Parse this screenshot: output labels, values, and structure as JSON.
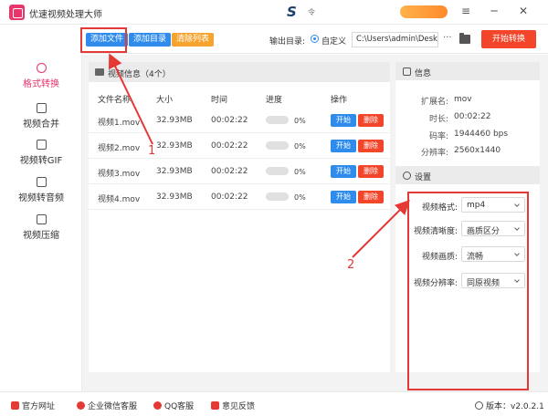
{
  "app": {
    "title": "优速视频处理大师",
    "brand_sub": "令"
  },
  "window_controls": [
    "≡",
    "─",
    "✕"
  ],
  "toolbar": {
    "add_file": "添加文件",
    "add_dir": "添加目录",
    "clear_list": "清除列表",
    "output_label": "输出目录:",
    "custom_label": "自定义",
    "path_value": "C:\\Users\\admin\\Deskto",
    "more": "···",
    "start_all": "开始转换"
  },
  "sidebar": {
    "items": [
      {
        "label": "格式转换",
        "icon": "format-convert-icon",
        "active": true
      },
      {
        "label": "视频合并",
        "icon": "video-merge-icon",
        "active": false
      },
      {
        "label": "视频转GIF",
        "icon": "gif-icon",
        "active": false
      },
      {
        "label": "视频转音频",
        "icon": "audio-icon",
        "active": false
      },
      {
        "label": "视频压缩",
        "icon": "compress-icon",
        "active": false
      }
    ]
  },
  "list": {
    "title": "视频信息（4个）",
    "columns": [
      "文件名称",
      "大小",
      "时间",
      "进度",
      "操作"
    ],
    "start_label": "开始",
    "delete_label": "删除",
    "rows": [
      {
        "name": "视频1.mov",
        "size": "32.93MB",
        "time": "00:02:22",
        "progress": "0%",
        "progress_value": 0
      },
      {
        "name": "视频2.mov",
        "size": "32.93MB",
        "time": "00:02:22",
        "progress": "0%",
        "progress_value": 0
      },
      {
        "name": "视频3.mov",
        "size": "32.93MB",
        "time": "00:02:22",
        "progress": "0%",
        "progress_value": 0
      },
      {
        "name": "视频4.mov",
        "size": "32.93MB",
        "time": "00:02:22",
        "progress": "0%",
        "progress_value": 0
      }
    ]
  },
  "info": {
    "title": "信息",
    "rows": [
      {
        "key": "扩展名:",
        "value": "mov"
      },
      {
        "key": "时长:",
        "value": "00:02:22"
      },
      {
        "key": "码率:",
        "value": "1944460 bps"
      },
      {
        "key": "分辨率:",
        "value": "2560x1440"
      }
    ]
  },
  "settings": {
    "title": "设置",
    "rows": [
      {
        "label": "视频格式:",
        "value": "mp4"
      },
      {
        "label": "视频清晰度:",
        "value": "画质区分"
      },
      {
        "label": "视频画质:",
        "value": "流畅"
      },
      {
        "label": "视频分辨率:",
        "value": "同原视频"
      }
    ]
  },
  "footer": {
    "website": "官方网址",
    "wechat": "企业微信客服",
    "qq": "QQ客服",
    "feedback": "意见反馈",
    "version": "版本：v2.0.2.1"
  },
  "annotations": {
    "label_1": "1",
    "label_2": "2"
  },
  "colors": {
    "accent_blue": "#2f8ced",
    "accent_red": "#f2452a",
    "brand_pink": "#e8356b",
    "annotation_red": "#e53935"
  }
}
